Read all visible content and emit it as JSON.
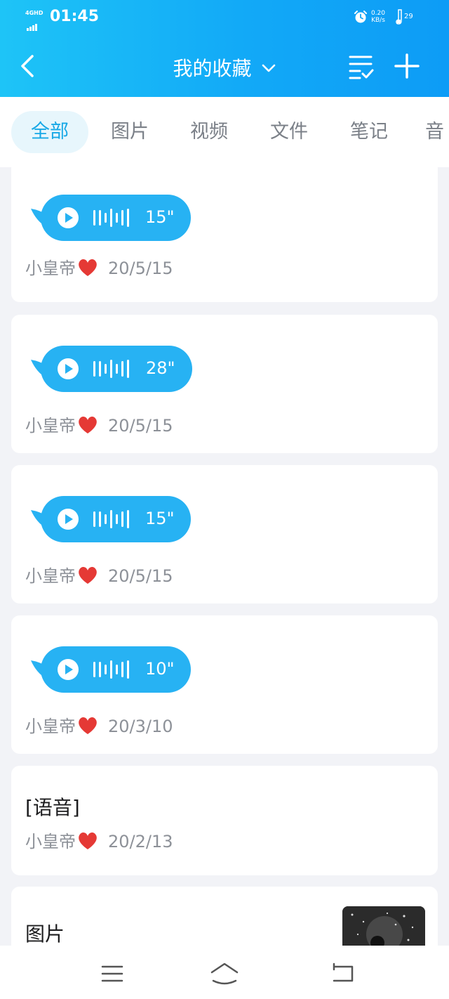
{
  "status_bar": {
    "network": "4GHD",
    "time": "01:45",
    "speed_value": "0.20",
    "speed_unit": "KB/s",
    "battery": "29"
  },
  "nav": {
    "title": "我的收藏"
  },
  "tabs": [
    {
      "label": "全部",
      "active": true
    },
    {
      "label": "图片",
      "active": false
    },
    {
      "label": "视频",
      "active": false
    },
    {
      "label": "文件",
      "active": false
    },
    {
      "label": "笔记",
      "active": false
    },
    {
      "label": "音",
      "active": false
    }
  ],
  "items": [
    {
      "type": "voice",
      "duration": "15\"",
      "author": "小皇帝",
      "date": "20/5/15"
    },
    {
      "type": "voice",
      "duration": "28\"",
      "author": "小皇帝",
      "date": "20/5/15"
    },
    {
      "type": "voice",
      "duration": "15\"",
      "author": "小皇帝",
      "date": "20/5/15"
    },
    {
      "type": "voice",
      "duration": "10\"",
      "author": "小皇帝",
      "date": "20/3/10"
    },
    {
      "type": "text",
      "title": "[语音]",
      "author": "小皇帝",
      "date": "20/2/13"
    },
    {
      "type": "image",
      "title": "图片"
    }
  ],
  "colors": {
    "header_start": "#1ec4f7",
    "header_end": "#0d9cf6",
    "voice_bubble": "#27b2f3",
    "tab_active_text": "#17a8e6",
    "tab_active_bg": "#e7f6fc",
    "heart": "#e53935"
  }
}
